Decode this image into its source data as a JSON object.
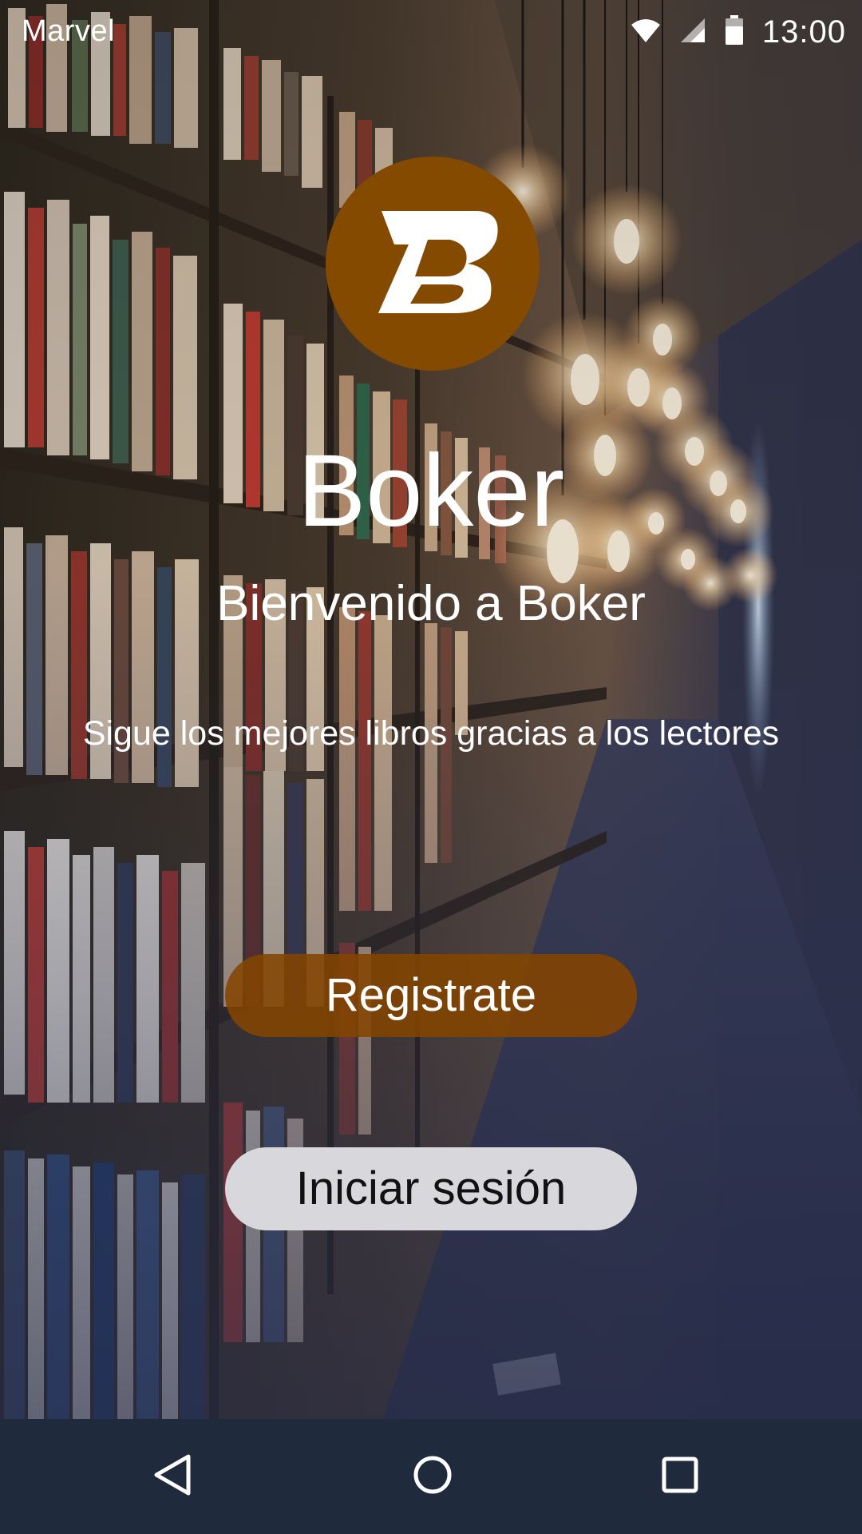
{
  "status_bar": {
    "carrier": "Marvel",
    "time": "13:00",
    "icons": [
      "wifi-icon",
      "signal-icon",
      "battery-icon"
    ]
  },
  "logo": {
    "letter": "B",
    "background_color": "#844a00"
  },
  "main": {
    "title": "Boker",
    "welcome": "Bienvenido a Boker",
    "tagline": "Sigue los mejores libros gracias a los lectores"
  },
  "buttons": {
    "register_label": "Registrate",
    "login_label": "Iniciar sesión",
    "register_color": "#844400",
    "login_color": "#d8d8dc"
  },
  "nav_bar": {
    "icons": [
      "back-icon",
      "home-icon",
      "recents-icon"
    ],
    "background_color": "#1f2a3d"
  }
}
